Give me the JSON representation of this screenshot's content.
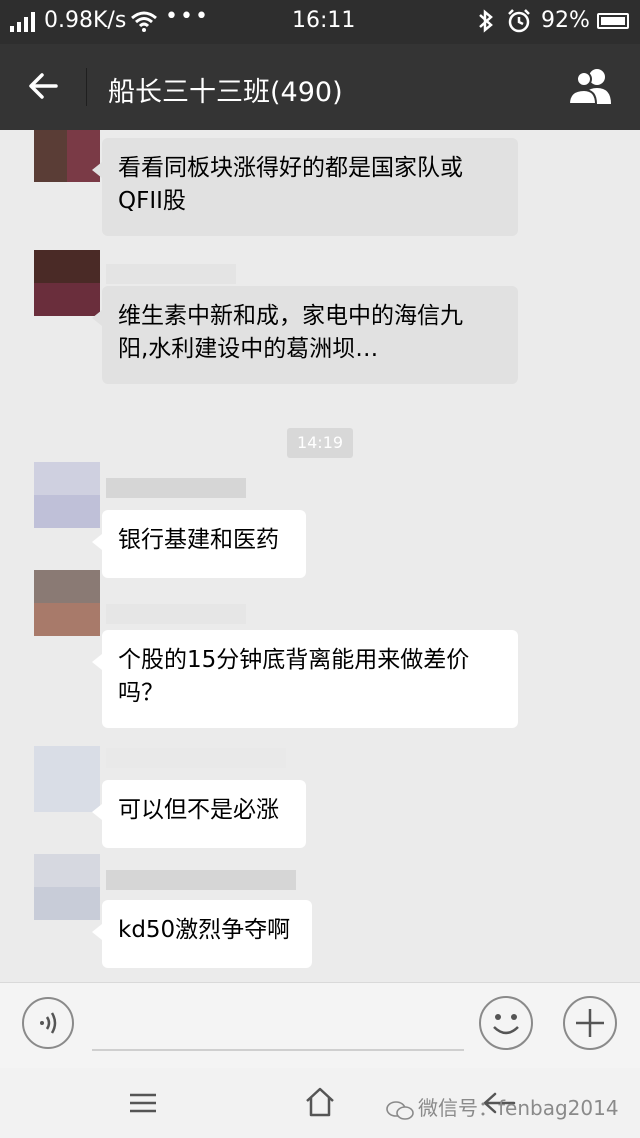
{
  "status_bar": {
    "speed": "0.98K/s",
    "time": "16:11",
    "battery": "92%",
    "icons": [
      "signal-icon",
      "wifi-icon",
      "more-dots-icon",
      "bluetooth-icon",
      "alarm-icon",
      "battery-icon"
    ]
  },
  "header": {
    "title": "船长三十三班(490)",
    "icons": [
      "back-arrow-icon",
      "group-members-icon"
    ]
  },
  "chat": {
    "timestamp": "14:19",
    "messages": [
      {
        "text_line1": "看看同板块涨得好的都是国家队或",
        "text_line2": "QFII股"
      },
      {
        "text_line1": "维生素中新和成，家电中的海信九",
        "text_line2": "阳,水利建设中的葛洲坝…"
      },
      {
        "text_line1": "银行基建和医药"
      },
      {
        "text_line1": "个股的15分钟底背离能用来做差价",
        "text_line2": "吗？"
      },
      {
        "text_line1": "可以但不是必涨"
      },
      {
        "text_line1": "kd50激烈争夺啊"
      }
    ]
  },
  "input_bar": {
    "icons": [
      "voice-icon",
      "emoji-icon",
      "plus-icon"
    ]
  },
  "nav_bar": {
    "icons": [
      "menu-icon",
      "home-icon",
      "back-nav-icon"
    ]
  },
  "watermark": {
    "text": "微信号：fenbag2014"
  },
  "colors": {
    "header_bg": "#343434",
    "status_bg": "#2e2e2e",
    "chat_bg": "#ebebeb",
    "bubble_white": "#ffffff",
    "bubble_grey": "#e1e1e1"
  }
}
